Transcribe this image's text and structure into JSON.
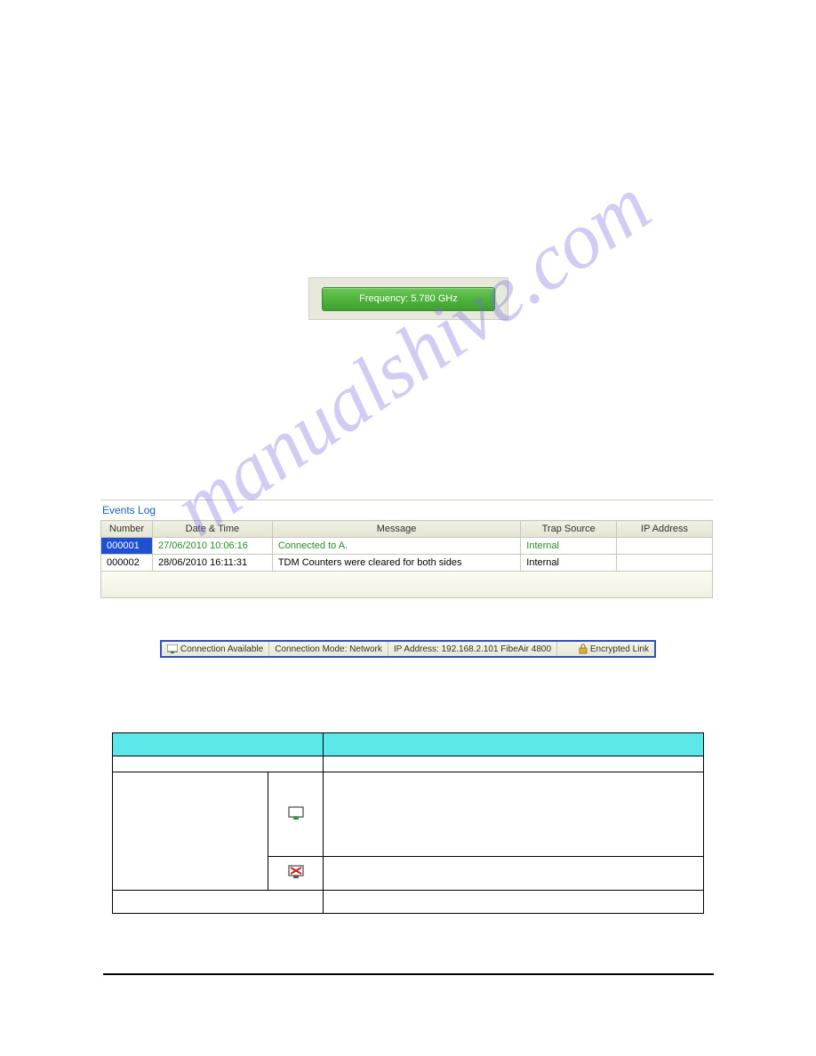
{
  "watermark": "manualshive.com",
  "frequency": {
    "label": "Frequency: 5.780 GHz"
  },
  "eventsLog": {
    "title": "Events Log",
    "headers": [
      "Number",
      "Date & Time",
      "Message",
      "Trap Source",
      "IP Address"
    ],
    "rows": [
      {
        "num": "000001",
        "datetime": "27/06/2010 10:06:16",
        "message": "Connected to A.",
        "trap": "Internal",
        "ip": "",
        "selected": true
      },
      {
        "num": "000002",
        "datetime": "28/06/2010 16:11:31",
        "message": "TDM Counters were cleared for both sides",
        "trap": "Internal",
        "ip": "",
        "selected": false
      }
    ]
  },
  "statusBar": {
    "connection": "Connection Available",
    "mode": "Connection Mode: Network",
    "ip": "IP Address: 192.168.2.101  FibeAir 4800",
    "encrypted": "Encrypted Link"
  },
  "iconTable": {
    "headers": [
      "",
      ""
    ]
  }
}
